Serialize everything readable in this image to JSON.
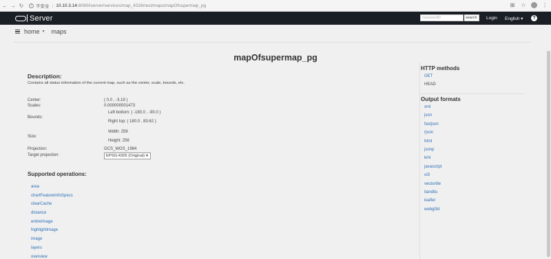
{
  "browser": {
    "insecure_label": "不安全",
    "url_host": "10.10.3.14",
    "url_path": ":8090/iserver/services/map_4326/rest/maps/mapOfsupermap_pg"
  },
  "navbar": {
    "logo_text": "Server",
    "search_placeholder": "resourceID",
    "search_button": "search",
    "login": "Login",
    "language": "English ▾",
    "help": "?"
  },
  "breadcrumb": {
    "home": "home",
    "current": "maps"
  },
  "page": {
    "title": "mapOfsupermap_pg",
    "description_heading": "Description:",
    "description_text": "Contains all status information of the current map, such as the center, scale, bounds, etc.",
    "center_label": "Center:",
    "center_value": "( 0.0 , -3.19 )",
    "scales_label": "Scales:",
    "scales_value": "0.000000001473",
    "bounds_label": "Bounds:",
    "bounds_left_bottom": "Left bottom: ( -180.0 , -90.0 )",
    "bounds_right_top": "Right top: ( 180.0 , 83.62 )",
    "size_label": "Size:",
    "size_width": "Width: 256",
    "size_height": "Height: 256",
    "projection_label": "Projection:",
    "projection_value": "GCS_WGS_1984",
    "target_projection_label": "Target projection:",
    "target_projection_value": "EPSG:4326 (Original)",
    "supported_ops_heading": "Supported operations:",
    "operations": [
      "area",
      "chartFeatureInfoSpecs",
      "clearCache",
      "distance",
      "entireImage",
      "highlightImage",
      "image",
      "layers",
      "overview"
    ]
  },
  "sidebar": {
    "http_heading": "HTTP methods",
    "http_methods": [
      "GET",
      "HEAD"
    ],
    "output_heading": "Output formats",
    "output_formats": [
      "xml",
      "json",
      "fastjson",
      "rjson",
      "html",
      "jsonp",
      "kml",
      "javascript",
      "ol3",
      "vectortile",
      "tianditu",
      "leaflet",
      "webgl3d"
    ]
  }
}
